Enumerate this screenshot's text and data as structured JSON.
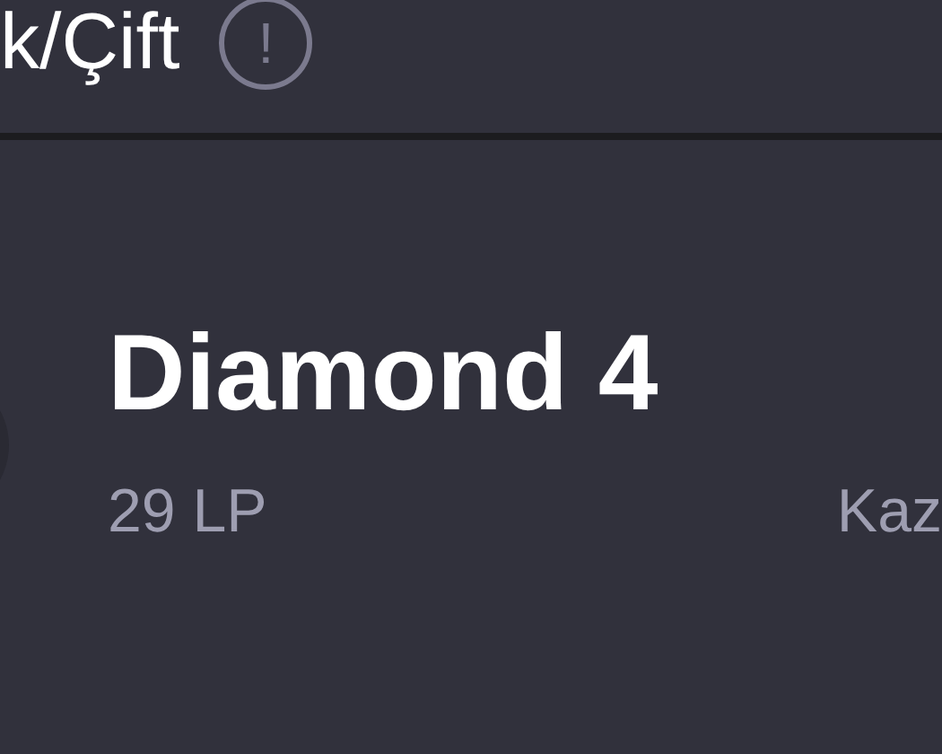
{
  "header": {
    "title": "k/Çift",
    "info_icon": "!"
  },
  "rank": {
    "tier": "Diamond 4",
    "lp": "29 LP",
    "column_3": "Kaz"
  }
}
